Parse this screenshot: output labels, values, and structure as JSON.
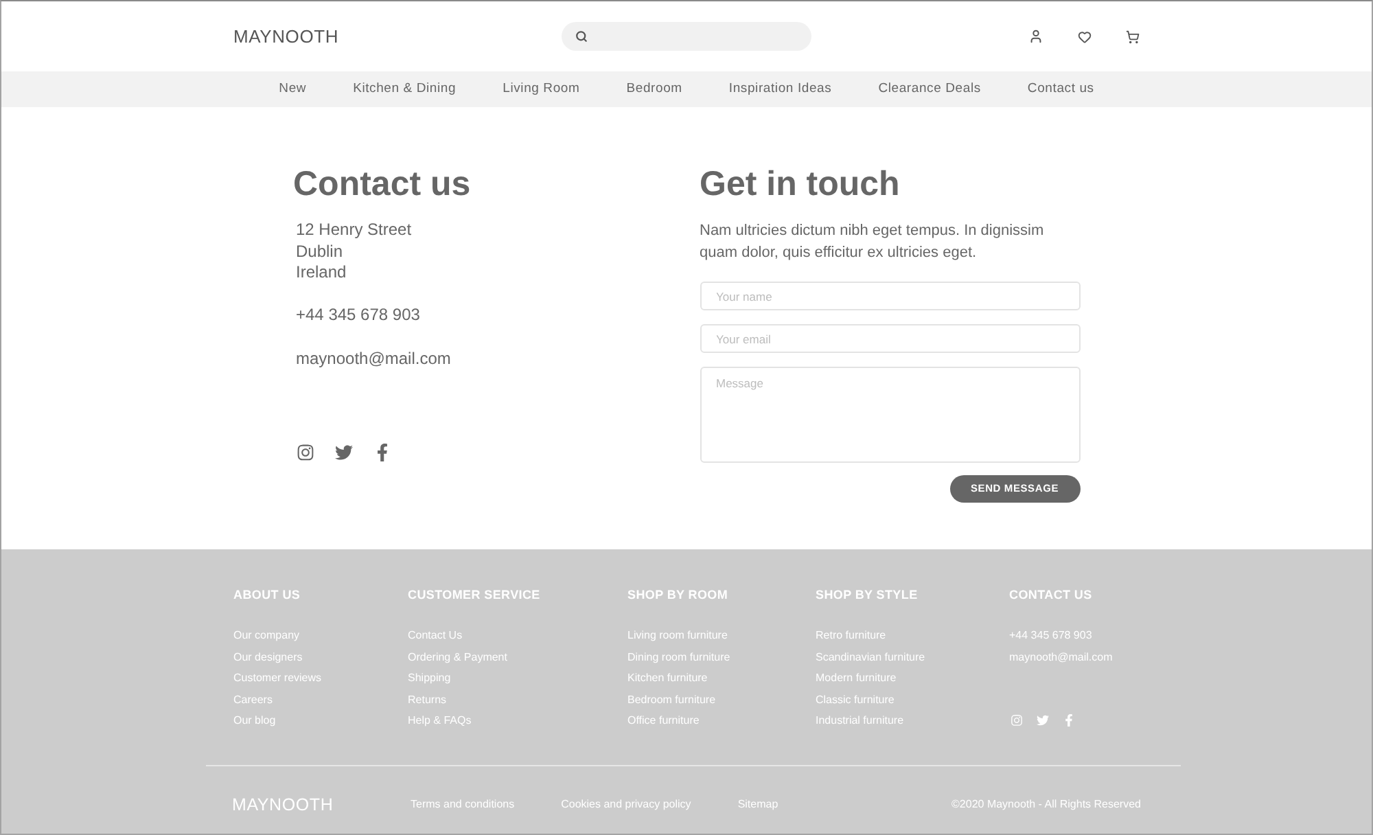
{
  "header": {
    "logo": "MAYNOOTH"
  },
  "nav": {
    "items": [
      "New",
      "Kitchen & Dining",
      "Living Room",
      "Bedroom",
      "Inspiration Ideas",
      "Clearance Deals",
      "Contact us"
    ]
  },
  "contact": {
    "title": "Contact us",
    "address": [
      "12 Henry Street",
      "Dublin",
      "Ireland"
    ],
    "phone": "+44 345 678 903",
    "email": "maynooth@mail.com"
  },
  "form": {
    "title": "Get in touch",
    "intro": "Nam ultricies dictum nibh eget tempus. In dignissim quam dolor, quis efficitur ex ultricies eget.",
    "fields": [
      {
        "kind": "input",
        "placeholder": "Your name"
      },
      {
        "kind": "input",
        "placeholder": "Your email"
      },
      {
        "kind": "textarea",
        "placeholder": "Message"
      }
    ],
    "submit": "SEND MESSAGE"
  },
  "footer": {
    "columns": [
      {
        "kind": "links",
        "title": "ABOUT US",
        "items": [
          "Our company",
          "Our designers",
          "Customer reviews",
          "Careers",
          "Our blog"
        ]
      },
      {
        "kind": "links",
        "title": "CUSTOMER SERVICE",
        "items": [
          "Contact Us",
          "Ordering & Payment",
          "Shipping",
          "Returns",
          "Help & FAQs"
        ]
      },
      {
        "kind": "links",
        "title": "SHOP BY ROOM",
        "items": [
          "Living room furniture",
          "Dining room furniture",
          "Kitchen furniture",
          "Bedroom furniture",
          "Office furniture"
        ]
      },
      {
        "kind": "links",
        "title": "SHOP BY STYLE",
        "items": [
          "Retro furniture",
          "Scandinavian furniture",
          "Modern furniture",
          "Classic furniture",
          "Industrial furniture"
        ]
      },
      {
        "kind": "contact",
        "title": "CONTACT US",
        "items": [
          "+44 345 678 903",
          "maynooth@mail.com"
        ]
      }
    ],
    "logo": "MAYNOOTH",
    "links": [
      "Terms and conditions",
      "Cookies and privacy policy",
      "Sitemap"
    ],
    "copyright": "©2020 Maynooth - All Rights Reserved"
  }
}
